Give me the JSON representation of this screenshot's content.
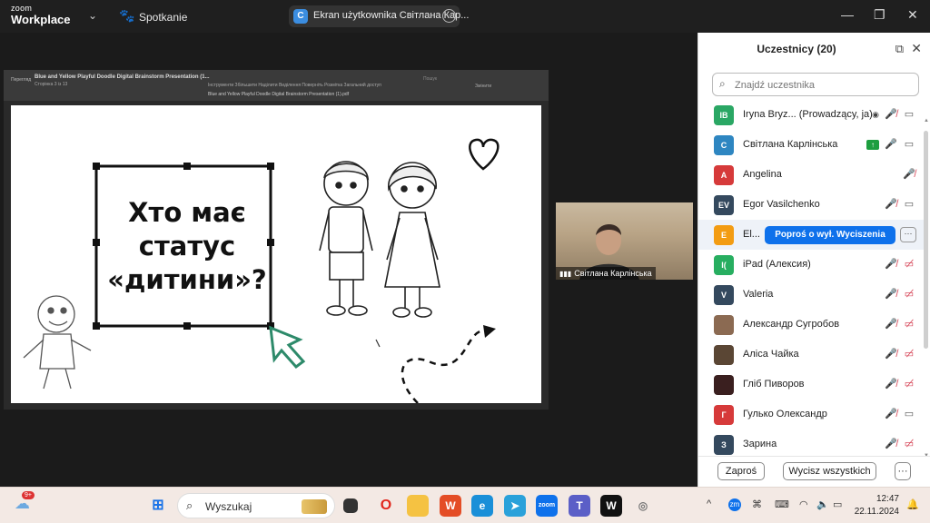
{
  "titlebar": {
    "logo_top": "zoom",
    "logo_bottom": "Workplace",
    "meeting_label": "Spotkanie",
    "share_title": "Ekran użytkownika Світлана Кар...",
    "share_icon_letter": "C"
  },
  "pdf": {
    "title": "Blue and Yellow Playful Doodle Digital Brainstorm Presentation (1...",
    "pages": "Сторінка 3 із 13",
    "left_label": "Перегляд",
    "tools": "Інструменти    Збільшити    Наділити    Виділення    Поверніть    Розмітка    Загальний доступ",
    "search": "Пошук",
    "share": "Змінити",
    "filename": "Blue and Yellow Playful Doodle Digital Brainstorm Presentation (1).pdf"
  },
  "slide": {
    "line1": "Хто має",
    "line2": "статус",
    "line3": "«дитини»?"
  },
  "video": {
    "name": "Світлана Карлінська"
  },
  "panel": {
    "title": "Uczestnicy (20)",
    "search_placeholder": "Znajdź uczestnika",
    "invite": "Zaproś",
    "mute_all": "Wycisz wszystkich",
    "more": "···",
    "participants": [
      {
        "initials": "IB",
        "name": "Iryna Bryz...  (Prowadzący, ja)",
        "color": "#2aa764",
        "mic": "muted",
        "video": "on",
        "host": true
      },
      {
        "initials": "C",
        "name": "Світлана Карлінська",
        "color": "#2e86c1",
        "mic": "on",
        "video": "on",
        "sharing": true
      },
      {
        "initials": "A",
        "name": "Angelina",
        "color": "#d63a3a",
        "mic": "muted",
        "video": "none"
      },
      {
        "initials": "EV",
        "name": "Egor Vasilchenko",
        "color": "#34495e",
        "mic": "muted",
        "video": "on"
      },
      {
        "initials": "E",
        "name": "El...",
        "color": "#f39c12",
        "ask_button": "Poproś o wył. Wyciszenia"
      },
      {
        "initials": "I(",
        "name": "iPad (Алексия)",
        "color": "#27ae60",
        "mic": "muted",
        "video": "off"
      },
      {
        "initials": "V",
        "name": "Valeria",
        "color": "#34495e",
        "mic": "muted",
        "video": "off"
      },
      {
        "initials": "",
        "name": "Александр Сугробов",
        "color": "#8b6a52",
        "mic": "muted",
        "video": "off"
      },
      {
        "initials": "",
        "name": "Аліса Чайка",
        "color": "#5a4634",
        "mic": "muted",
        "video": "off"
      },
      {
        "initials": "",
        "name": "Гліб Пиворов",
        "color": "#3a1f1f",
        "mic": "muted",
        "video": "off"
      },
      {
        "initials": "Г",
        "name": "Гулько Олександр",
        "color": "#d63a3a",
        "mic": "muted",
        "video": "on"
      },
      {
        "initials": "З",
        "name": "Зарина",
        "color": "#34495e",
        "mic": "muted",
        "video": "off"
      }
    ]
  },
  "taskbar": {
    "search_label": "Wyszukaj",
    "weather_badge": "9+",
    "time": "12:47",
    "date": "22.11.2024"
  },
  "icons": {
    "mic_muted": "🎤̸",
    "camera": "▭"
  }
}
